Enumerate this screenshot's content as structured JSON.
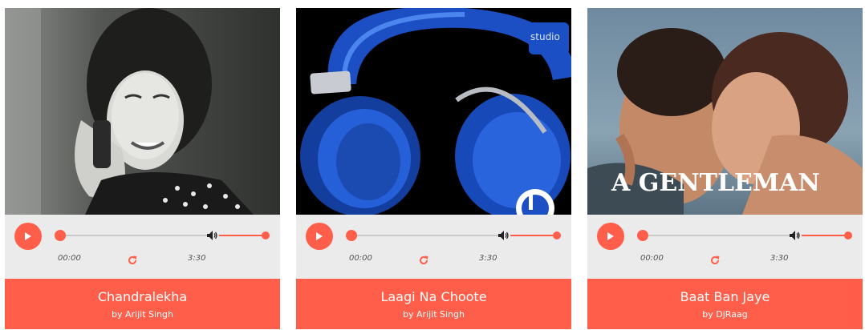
{
  "colors": {
    "accent": "#ff5f4a",
    "player_bg": "#ebebeb",
    "track": "#c9c9c9"
  },
  "players": [
    {
      "artwork": "woman-on-phone-bw-photo",
      "current_time": "00:00",
      "duration": "3:30",
      "progress_fraction": 0,
      "volume_fraction": 1.0,
      "title": "Chandralekha",
      "artist": "by Arijit Singh"
    },
    {
      "artwork": "blue-headphones-photo",
      "artwork_text": "studio",
      "current_time": "00:00",
      "duration": "3:30",
      "progress_fraction": 0,
      "volume_fraction": 1.0,
      "title": "Laagi Na Choote",
      "artist": "by Arijit Singh"
    },
    {
      "artwork": "movie-poster-a-gentleman",
      "artwork_text": "A GENTLEMAN",
      "current_time": "00:00",
      "duration": "3:30",
      "progress_fraction": 0,
      "volume_fraction": 1.0,
      "title": "Baat Ban Jaye",
      "artist": "by DjRaag"
    }
  ],
  "icons": {
    "play": "play-icon",
    "volume": "volume-icon",
    "repeat": "repeat-icon"
  }
}
